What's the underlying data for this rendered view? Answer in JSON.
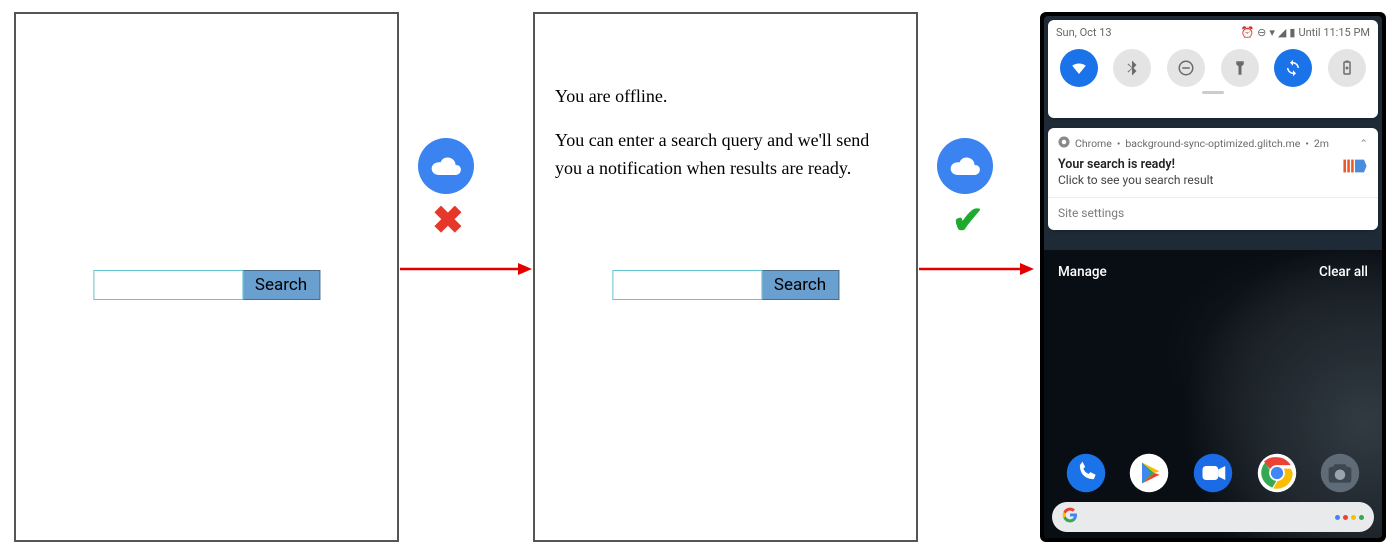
{
  "panel1": {
    "search_button": "Search"
  },
  "panel2": {
    "offline_line1": "You are offline.",
    "offline_line2": "You can enter a search query and we'll send you a notification when results are ready.",
    "search_button": "Search"
  },
  "transitions": {
    "step1": {
      "connectivity": "offline"
    },
    "step2": {
      "connectivity": "online"
    }
  },
  "phone": {
    "statusbar": {
      "date": "Sun, Oct 13",
      "alarm_icon": "alarm",
      "dnd_icon": "do-not-disturb",
      "wifi_icon": "wifi",
      "signal_icon": "signal",
      "battery_icon": "battery",
      "until_text": "Until 11:15 PM"
    },
    "quick_settings": {
      "wifi": {
        "on": true
      },
      "bluetooth": {
        "on": false
      },
      "dnd": {
        "on": false
      },
      "flashlight": {
        "on": false
      },
      "autorotate": {
        "on": true
      },
      "battery_saver": {
        "on": false
      }
    },
    "notification": {
      "app": "Chrome",
      "source": "background-sync-optimized.glitch.me",
      "age": "2m",
      "title": "Your search is ready!",
      "body": "Click to see you search result",
      "site_settings": "Site settings"
    },
    "shade": {
      "manage": "Manage",
      "clear_all": "Clear all"
    },
    "dock": {
      "phone": "phone",
      "play": "play-store",
      "duo": "duo",
      "chrome": "chrome",
      "camera": "camera"
    },
    "searchpill": {
      "assistant": "assistant"
    }
  }
}
